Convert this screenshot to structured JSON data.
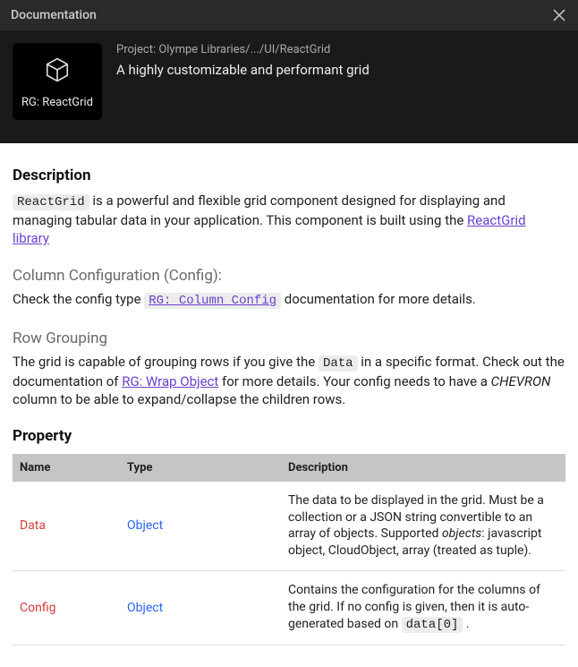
{
  "header": {
    "title": "Documentation",
    "close_label": "Close"
  },
  "card": {
    "chip_label": "RG: ReactGrid",
    "project_line": "Project: Olympe Libraries/.../UI/ReactGrid",
    "summary": "A highly customizable and performant grid"
  },
  "sections": {
    "description_heading": "Description",
    "desc_code": "ReactGrid",
    "desc_text_after_code": " is a powerful and flexible grid component designed for displaying and managing tabular data in your application. This component is built using the ",
    "desc_link_text": "ReactGrid library",
    "config_heading": "Column Configuration (Config):",
    "config_text_before_link": "Check the config type ",
    "config_link_text": "RG: Column Config",
    "config_text_after_link": " documentation for more details.",
    "group_heading": "Row Grouping",
    "group_text1": "The grid is capable of grouping rows if you give the ",
    "group_code1": "Data",
    "group_text2": " in a specific format. Check out the documentation of ",
    "group_link": "RG: Wrap Object",
    "group_text3": " for more details. Your config needs to have a ",
    "group_italic": "CHEVRON",
    "group_text4": " column to be able to expand/collapse the children rows.",
    "property_heading": "Property"
  },
  "table": {
    "headers": {
      "name": "Name",
      "type": "Type",
      "description": "Description"
    },
    "rows": [
      {
        "name": "Data",
        "type": "Object",
        "desc_pre": "The data to be displayed in the grid. Must be a collection or a JSON string convertible to an array of objects. Supported ",
        "desc_italic": "objects",
        "desc_post": ": javascript object, CloudObject, array (treated as tuple).",
        "desc_code": ""
      },
      {
        "name": "Config",
        "type": "Object",
        "desc_pre": "Contains the configuration for the columns of the grid. If no config is given, then it is auto-generated based on ",
        "desc_italic": "",
        "desc_post": " .",
        "desc_code": "data[0]"
      }
    ]
  }
}
